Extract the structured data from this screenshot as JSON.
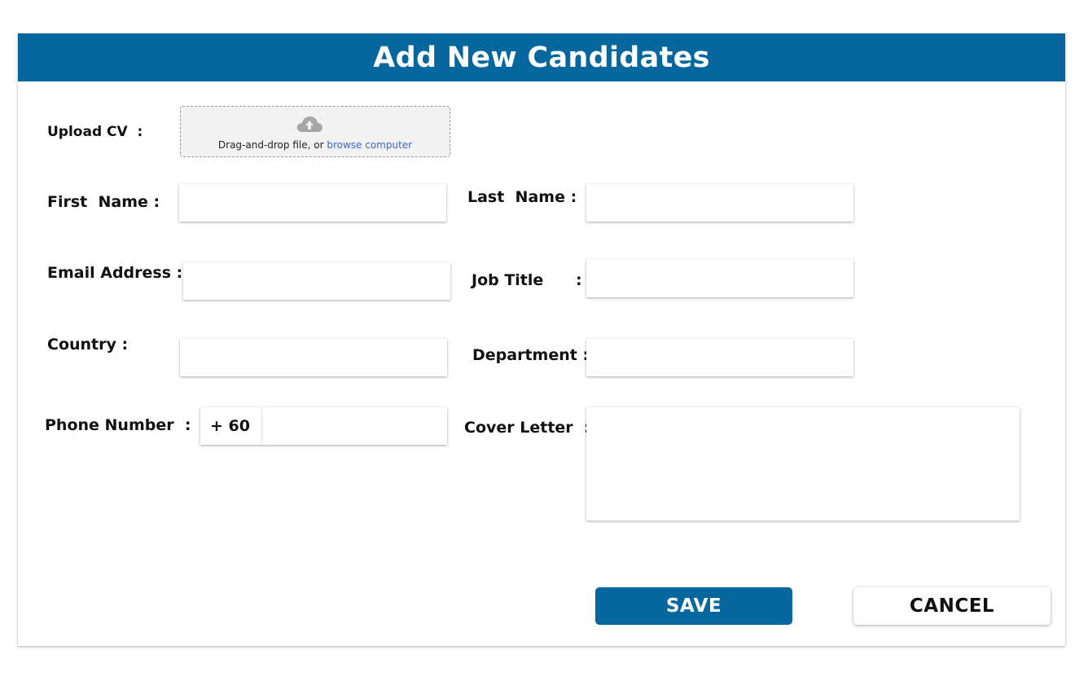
{
  "header": {
    "title": "Add New Candidates"
  },
  "upload": {
    "label": "Upload CV  :",
    "drop_text": "Drag-and-drop file, or ",
    "browse_text": "browse computer",
    "icon": "cloud-upload-icon"
  },
  "fields": {
    "first_name": {
      "label": "First  Name :",
      "value": ""
    },
    "last_name": {
      "label": "Last  Name :",
      "value": ""
    },
    "email": {
      "label": "Email Address :",
      "value": ""
    },
    "job_title": {
      "label": "Job Title      :",
      "value": ""
    },
    "country": {
      "label": "Country :",
      "value": ""
    },
    "department": {
      "label": "Department :",
      "value": ""
    },
    "phone": {
      "label": "Phone Number  :",
      "prefix": "+ 60",
      "value": ""
    },
    "cover_letter": {
      "label": "Cover Letter  :",
      "value": ""
    }
  },
  "buttons": {
    "save": "SAVE",
    "cancel": "CANCEL"
  },
  "colors": {
    "brand": "#05679e",
    "link": "#3a67d9"
  }
}
